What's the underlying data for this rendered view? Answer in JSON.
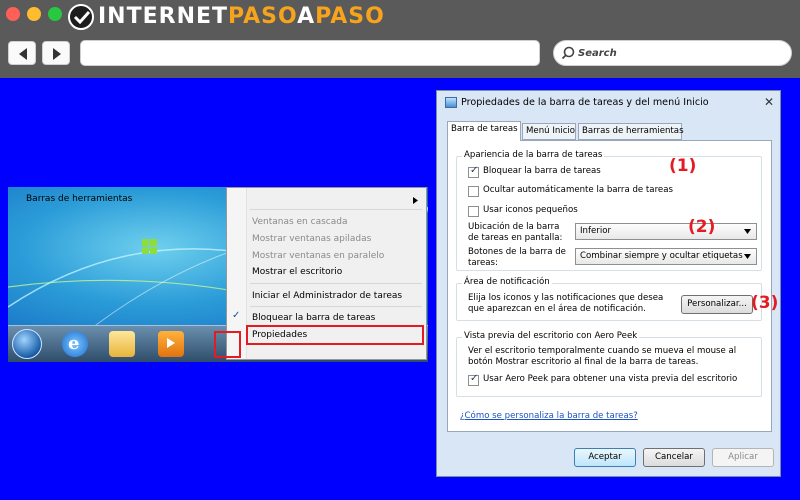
{
  "browser": {
    "logo": {
      "part1": "INTERNET",
      "part2": "PASO",
      "part3": "A",
      "part4": "PASO"
    },
    "search_placeholder": "Search"
  },
  "context_menu": {
    "items": [
      {
        "label": "Barras de herramientas",
        "enabled": true
      },
      {
        "label": "Ventanas en cascada",
        "enabled": false
      },
      {
        "label": "Mostrar ventanas apiladas",
        "enabled": false
      },
      {
        "label": "Mostrar ventanas en paralelo",
        "enabled": false
      },
      {
        "label": "Mostrar el escritorio",
        "enabled": true
      },
      {
        "label": "Iniciar el Administrador de tareas",
        "enabled": true
      },
      {
        "label": "Bloquear la barra de tareas",
        "enabled": true,
        "checked": true
      },
      {
        "label": "Propiedades",
        "enabled": true
      }
    ]
  },
  "dialog": {
    "title": "Propiedades de la barra de tareas y del menú Inicio",
    "tabs": [
      {
        "label": "Barra de tareas",
        "active": true
      },
      {
        "label": "Menú Inicio",
        "active": false
      },
      {
        "label": "Barras de herramientas",
        "active": false
      }
    ],
    "appearance": {
      "title": "Apariencia de la barra de tareas",
      "lock": {
        "label": "Bloquear la barra de tareas",
        "checked": true
      },
      "autohide": {
        "label": "Ocultar automáticamente la barra de tareas",
        "checked": false
      },
      "small_icons": {
        "label": "Usar iconos pequeños",
        "checked": false
      },
      "location_label": "Ubicación de la barra de tareas en pantalla:",
      "location_value": "Inferior",
      "buttons_label": "Botones de la barra de tareas:",
      "buttons_value": "Combinar siempre y ocultar etiquetas"
    },
    "notification": {
      "title": "Área de notificación",
      "text": "Elija los iconos y las notificaciones que desea que aparezcan en el área de notificación.",
      "button": "Personalizar..."
    },
    "aero": {
      "title": "Vista previa del escritorio con Aero Peek",
      "text": "Ver el escritorio temporalmente cuando se mueva el mouse al botón Mostrar escritorio al final de la barra de tareas.",
      "checkbox": {
        "label": "Usar Aero Peek para obtener una vista previa del escritorio",
        "checked": true
      }
    },
    "help_link": "¿Cómo se personaliza la barra de tareas?",
    "buttons": {
      "accept": "Aceptar",
      "cancel": "Cancelar",
      "apply": "Aplicar"
    }
  },
  "annotations": [
    "(1)",
    "(2)",
    "(3)"
  ],
  "colors": {
    "background": "#0000ff",
    "highlight": "#e51b23",
    "logo_accent": "#f7a41c"
  }
}
